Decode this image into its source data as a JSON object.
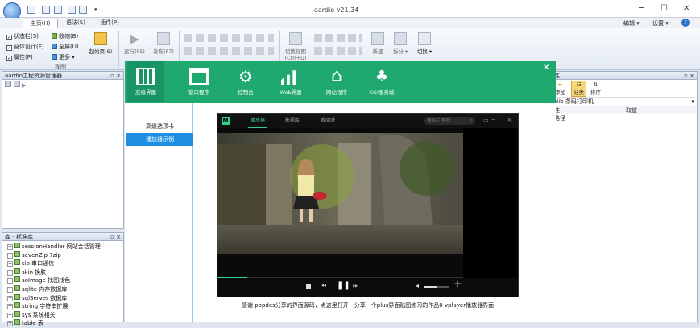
{
  "app": {
    "title": "aardio v21.34"
  },
  "menu": {
    "tabs": [
      "主页(H)",
      "语法(S)",
      "插件(P)"
    ],
    "right": {
      "edit": "编辑",
      "settings": "设置",
      "help": "?"
    }
  },
  "ribbon": {
    "view_checks": [
      {
        "label": "状态栏(S)",
        "checked": true
      },
      {
        "label": "窗体设计(F)",
        "checked": true
      },
      {
        "label": "属性(P)",
        "checked": true
      }
    ],
    "view_checks2": [
      {
        "label": "收缩(B)",
        "checked": true
      },
      {
        "label": "全屏(U)",
        "checked": true
      },
      {
        "label": "更多",
        "checked": false
      }
    ],
    "start_page": "起始页(S)",
    "group_view": "视图",
    "run": "运行(F5)",
    "publish": "发布(F7)",
    "switch_view": "切换视图",
    "switch_view_key": "(Ctrl+U)",
    "new": "新建",
    "split": "拆分",
    "switch": "切换"
  },
  "left_panel": {
    "title": "aardio工程资源管理器",
    "pin": "▫ ×"
  },
  "lib_panel": {
    "title": "库 - 标准库",
    "items": [
      "sessionHandler 网站会话管理",
      "sevenZip 7zip",
      "sio 串口通信",
      "skin 换肤",
      "soImage 找图找色",
      "sqlite 内存数据库",
      "sqlServer 数据库",
      "string 字符串扩展",
      "sys 系统相关",
      "table 表"
    ]
  },
  "right_panel": {
    "title": "性",
    "btn_add": "添加",
    "btn_category": "分类",
    "btn_sort": "排序",
    "combo": "olib 条码打印机",
    "col_name": "性",
    "col_value": "取值",
    "row1": "路径"
  },
  "demo": {
    "close": "×",
    "tabs": [
      "高级界面",
      "窗口程序",
      "控制台",
      "Web界面",
      "网站程序",
      "CGI服务端"
    ],
    "nav": [
      "高级选项卡",
      "播放器示例"
    ],
    "caption": "感谢 popdes分享的界面源码，点这里打开：分享一个plus界面贴图练习的作品0 vplayer播放器界面"
  },
  "player": {
    "logo": "M",
    "tabs": [
      "播放器",
      "影视库",
      "看动漫"
    ],
    "search_placeholder": "搜影片·电视",
    "progress": 0.12,
    "volume": 0.5
  },
  "colors": {
    "accent": "#1fa870",
    "accent_dark": "#189563",
    "nav_active": "#1e8fe1"
  }
}
